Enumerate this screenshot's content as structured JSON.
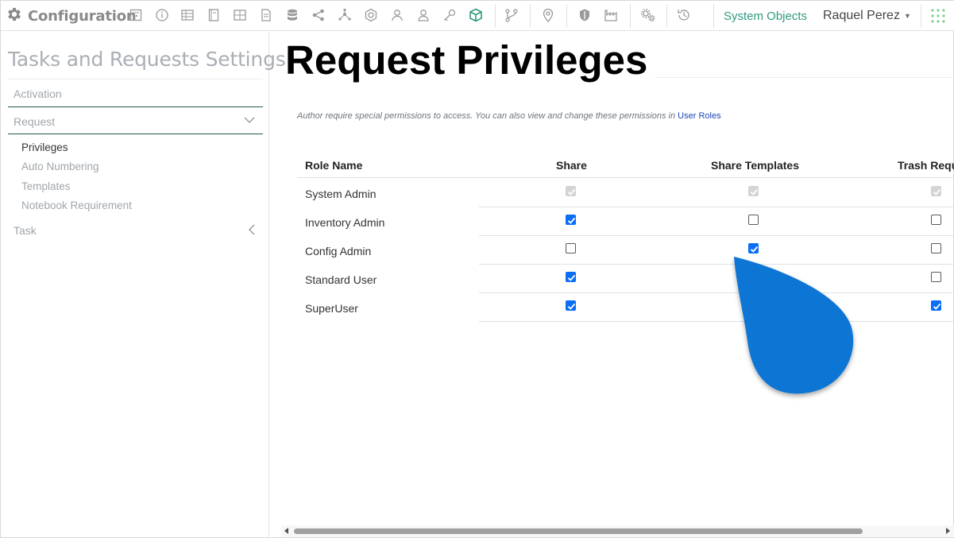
{
  "topbar": {
    "app_title": "Configuration",
    "system_objects_label": "System Objects",
    "user_name": "Raquel Perez"
  },
  "sidebar": {
    "title": "Tasks and Requests Settings",
    "activation_label": "Activation",
    "request_label": "Request",
    "request_items": [
      {
        "label": "Privileges",
        "active": true
      },
      {
        "label": "Auto Numbering",
        "active": false
      },
      {
        "label": "Templates",
        "active": false
      },
      {
        "label": "Notebook Requirement",
        "active": false
      }
    ],
    "task_label": "Task"
  },
  "main": {
    "title": "Request Privileges",
    "note_text": "Author require special permissions to access. You can also view and change these permissions in ",
    "note_link": "User Roles",
    "columns": [
      "Role Name",
      "Share",
      "Share Templates",
      "Trash Requ"
    ],
    "rows": [
      {
        "role": "System Admin",
        "share": true,
        "share_templates": true,
        "trash": true,
        "disabled": true
      },
      {
        "role": "Inventory Admin",
        "share": true,
        "share_templates": false,
        "trash": false,
        "disabled": false
      },
      {
        "role": "Config Admin",
        "share": false,
        "share_templates": true,
        "trash": false,
        "disabled": false
      },
      {
        "role": "Standard User",
        "share": true,
        "share_templates": null,
        "trash": false,
        "disabled": false
      },
      {
        "role": "SuperUser",
        "share": true,
        "share_templates": null,
        "trash": true,
        "disabled": false
      }
    ]
  },
  "colors": {
    "accent_green": "#2e9a7e",
    "checkbox_blue": "#0b6ef6",
    "pointer_blue": "#0a74d4",
    "link_blue": "#1a47b8"
  }
}
